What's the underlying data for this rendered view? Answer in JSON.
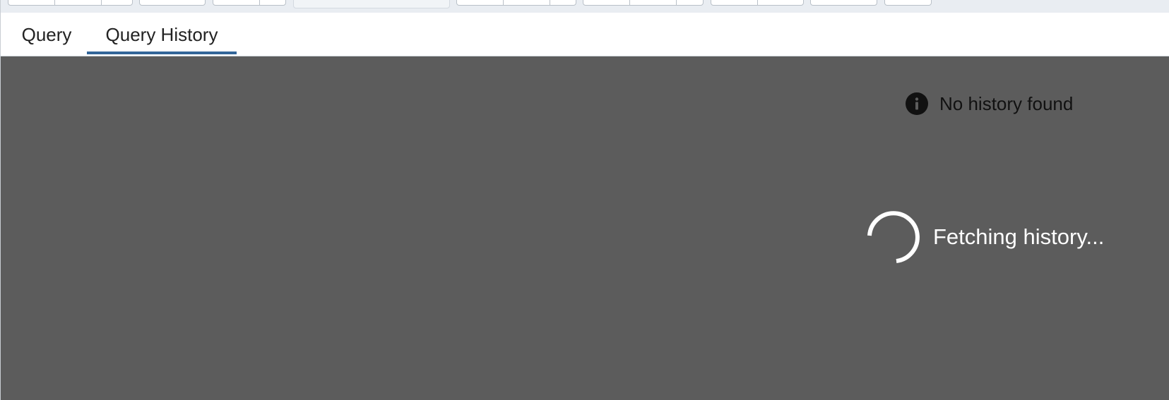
{
  "tabs": [
    {
      "label": "Query",
      "active": false
    },
    {
      "label": "Query History",
      "active": true
    }
  ],
  "history": {
    "notice": "No history found",
    "notice_icon": "info-icon",
    "loading_text": "Fetching history...",
    "loading_icon": "spinner-icon"
  },
  "colors": {
    "accent": "#336699",
    "overlay": "#5c5c5c",
    "loader": "#ffffff"
  }
}
